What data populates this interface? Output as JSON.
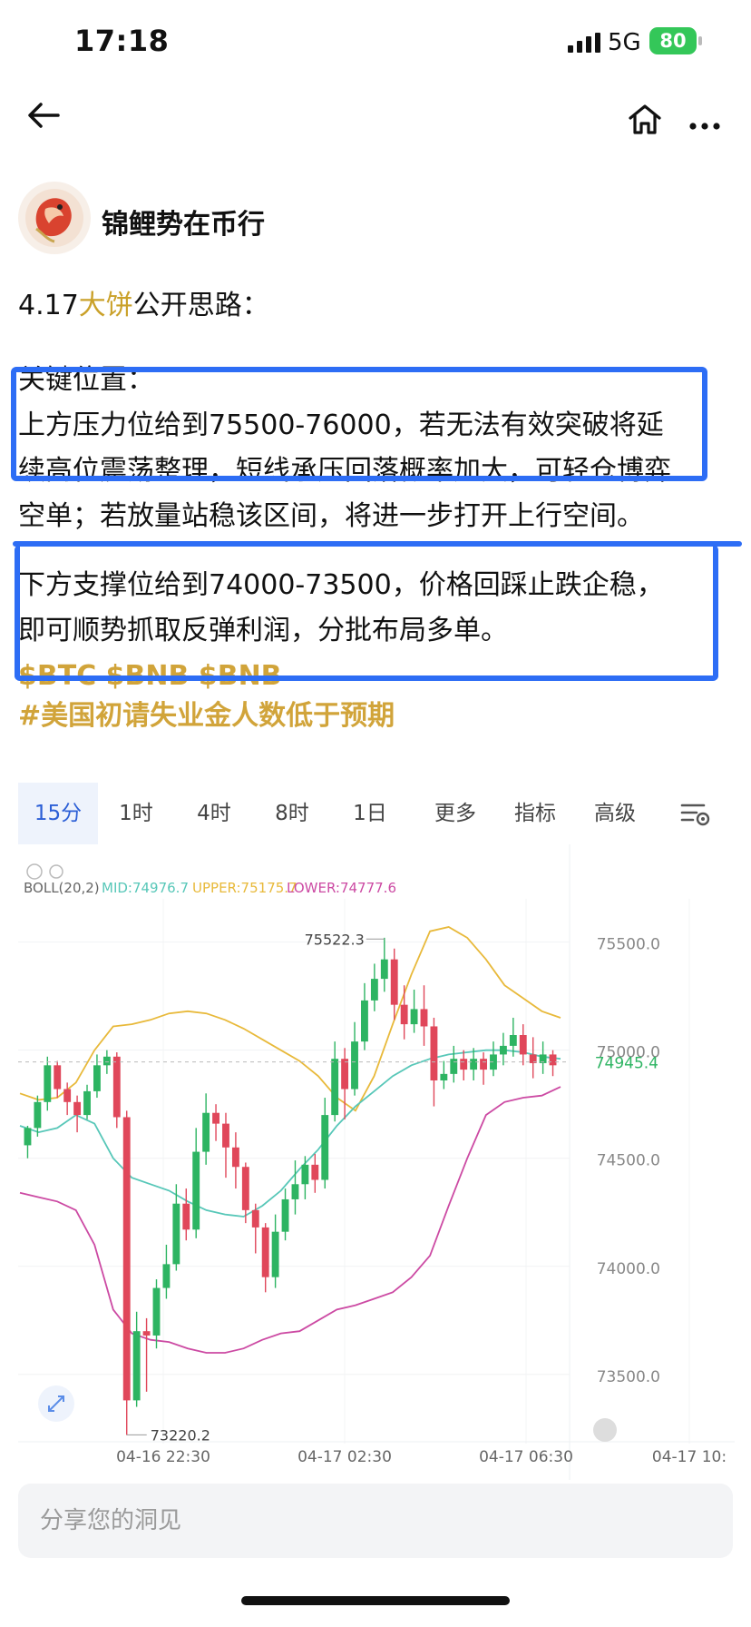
{
  "status": {
    "time": "17:18",
    "network": "5G",
    "battery": "80"
  },
  "author": {
    "name": "锦鲤势在币行"
  },
  "post": {
    "title_prefix": "4.17",
    "title_highlight": "大饼",
    "title_suffix": "公开思路：",
    "key_heading": "关键位置：",
    "resistance_line1": "上方压力位给到75500-76000，若无法有效突破将延",
    "resistance_line2": "续高位震荡整理，短线承压回落概率加大，可轻仓博弈",
    "resistance_line3": "空单；若放量站稳该区间，将进一步打开上行空间。",
    "support_line1": "下方支撑位给到74000-73500，价格回踩止跌企稳，",
    "support_line2": "即可顺势抓取反弹利润，分批布局多单。",
    "cashtags": "$BTC $BNB $BNB",
    "hashtag": "#美国初请失业金人数低于预期"
  },
  "chart": {
    "tabs": [
      "15分",
      "1时",
      "4时",
      "8时",
      "1日",
      "更多",
      "指标",
      "高级"
    ],
    "active_tab": "15分",
    "boll_label": "BOLL(20,2)",
    "mid_label": "MID:74976.7",
    "upper_label": "UPPER:75175.7",
    "lower_label": "LOWER:74777.6",
    "high_marker": "75522.3",
    "low_marker": "73220.2",
    "current_price": "74945.4",
    "colors": {
      "up": "#2db462",
      "down": "#e0475a",
      "upper": "#e8b93a",
      "mid": "#57c7b8",
      "lower": "#cc4aa3",
      "active_tab": "#2c5fd6"
    }
  },
  "chart_data": {
    "type": "candlestick",
    "y_ticks": [
      "75500.0",
      "75000.0",
      "74500.0",
      "74000.0",
      "73500.0"
    ],
    "x_ticks": [
      "04-16 22:30",
      "04-17 02:30",
      "04-17 06:30",
      "04-17 10:"
    ],
    "ylim": [
      73180,
      75700
    ],
    "candles": [
      [
        74560,
        74640,
        74500,
        74650
      ],
      [
        74640,
        74760,
        74600,
        74790
      ],
      [
        74760,
        74930,
        74720,
        74970
      ],
      [
        74930,
        74820,
        74780,
        74950
      ],
      [
        74820,
        74760,
        74700,
        74850
      ],
      [
        74760,
        74700,
        74620,
        74790
      ],
      [
        74700,
        74810,
        74680,
        74840
      ],
      [
        74810,
        74930,
        74780,
        74980
      ],
      [
        74930,
        74970,
        74890,
        75000
      ],
      [
        74970,
        74690,
        74640,
        74990
      ],
      [
        74690,
        73380,
        73220,
        74720
      ],
      [
        73380,
        73700,
        73350,
        73790
      ],
      [
        73700,
        73680,
        73420,
        73760
      ],
      [
        73680,
        73900,
        73620,
        73940
      ],
      [
        73900,
        74010,
        73850,
        74100
      ],
      [
        74010,
        74290,
        73980,
        74380
      ],
      [
        74290,
        74170,
        74120,
        74360
      ],
      [
        74170,
        74530,
        74130,
        74640
      ],
      [
        74530,
        74710,
        74470,
        74800
      ],
      [
        74710,
        74660,
        74580,
        74750
      ],
      [
        74660,
        74550,
        74410,
        74710
      ],
      [
        74550,
        74460,
        74360,
        74620
      ],
      [
        74460,
        74260,
        74200,
        74480
      ],
      [
        74260,
        74180,
        74060,
        74290
      ],
      [
        74180,
        73950,
        73880,
        74200
      ],
      [
        73950,
        74160,
        73900,
        74240
      ],
      [
        74160,
        74310,
        74120,
        74360
      ],
      [
        74310,
        74380,
        74240,
        74490
      ],
      [
        74380,
        74470,
        74310,
        74510
      ],
      [
        74470,
        74400,
        74340,
        74520
      ],
      [
        74400,
        74700,
        74360,
        74780
      ],
      [
        74700,
        74960,
        74670,
        75040
      ],
      [
        74960,
        74820,
        74680,
        75010
      ],
      [
        74820,
        75040,
        74790,
        75130
      ],
      [
        75040,
        75230,
        75000,
        75310
      ],
      [
        75230,
        75330,
        75180,
        75400
      ],
      [
        75330,
        75420,
        75270,
        75520
      ],
      [
        75420,
        75210,
        75140,
        75470
      ],
      [
        75210,
        75120,
        75050,
        75300
      ],
      [
        75120,
        75190,
        75080,
        75280
      ],
      [
        75190,
        75110,
        75020,
        75300
      ],
      [
        75110,
        74860,
        74740,
        75150
      ],
      [
        74860,
        74890,
        74820,
        74950
      ],
      [
        74890,
        74960,
        74850,
        75020
      ],
      [
        74960,
        74910,
        74860,
        75000
      ],
      [
        74910,
        74960,
        74860,
        75010
      ],
      [
        74960,
        74910,
        74840,
        74990
      ],
      [
        74910,
        74980,
        74880,
        75040
      ],
      [
        74980,
        75020,
        74930,
        75080
      ],
      [
        75020,
        75070,
        74970,
        75150
      ],
      [
        75070,
        74980,
        74930,
        75120
      ],
      [
        74980,
        74940,
        74870,
        75060
      ],
      [
        74940,
        74980,
        74890,
        75040
      ],
      [
        74980,
        74930,
        74880,
        75000
      ]
    ],
    "upper": [
      74800,
      74770,
      74780,
      74850,
      75000,
      75110,
      75120,
      75140,
      75170,
      75180,
      75170,
      75140,
      75100,
      75050,
      75000,
      74950,
      74880,
      74780,
      74720,
      74880,
      75120,
      75350,
      75550,
      75570,
      75520,
      75420,
      75300,
      75240,
      75180,
      75150
    ],
    "mid": [
      74650,
      74620,
      74640,
      74700,
      74660,
      74500,
      74410,
      74380,
      74350,
      74300,
      74260,
      74240,
      74230,
      74280,
      74350,
      74450,
      74540,
      74650,
      74740,
      74810,
      74880,
      74930,
      74960,
      74980,
      74990,
      75000,
      75000,
      74990,
      74970,
      74960
    ],
    "lower": [
      74340,
      74320,
      74300,
      74260,
      74100,
      73800,
      73690,
      73660,
      73650,
      73620,
      73600,
      73600,
      73620,
      73660,
      73690,
      73700,
      73750,
      73800,
      73820,
      73850,
      73880,
      73950,
      74050,
      74280,
      74500,
      74700,
      74760,
      74780,
      74790,
      74830
    ]
  }
}
